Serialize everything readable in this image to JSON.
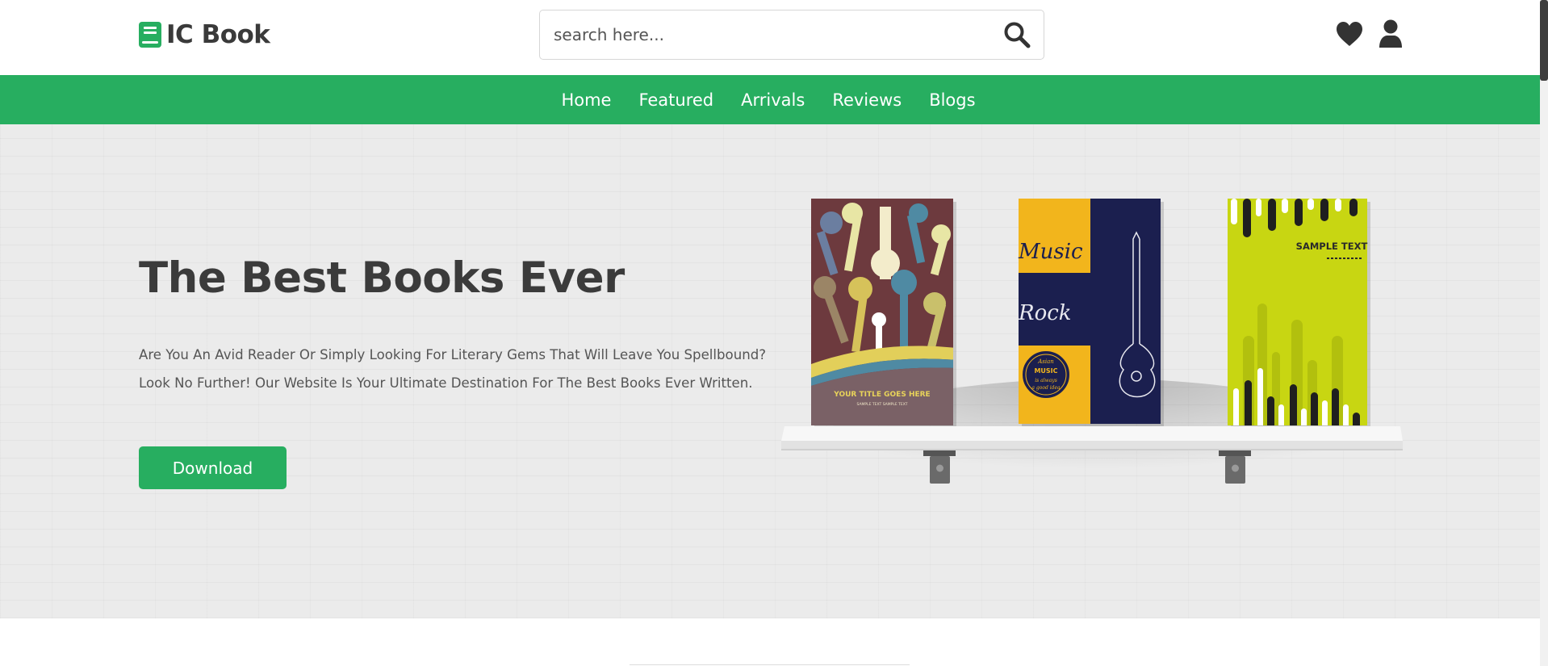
{
  "header": {
    "logo_text": "IC Book",
    "search": {
      "placeholder": "search here...",
      "value": ""
    }
  },
  "icons": {
    "logo": "book-icon",
    "search": "search-icon",
    "wishlist": "heart-icon",
    "account": "user-icon"
  },
  "nav": {
    "links": [
      "Home",
      "Featured",
      "Arrivals",
      "Reviews",
      "Blogs"
    ]
  },
  "hero": {
    "title": "The Best Books Ever",
    "description": "Are You An Avid Reader Or Simply Looking For Literary Gems That Will Leave You Spellbound? Look No Further! Our Website Is Your Ultimate Destination For The Best Books Ever Written.",
    "button_label": "Download"
  },
  "book_covers": {
    "book1": {
      "title_text": "YOUR TITLE GOES HERE",
      "subtitle_text": "SAMPLE TEXT SAMPLE TEXT"
    },
    "book2": {
      "word1": "Music",
      "word2": "Rock",
      "badge_lines": [
        "Asian",
        "MUSIC",
        "is always",
        "a good idea"
      ]
    },
    "book3": {
      "title_text": "SAMPLE TEXT"
    }
  },
  "colors": {
    "brand_green": "#27ae60",
    "text_dark": "#3b3b3b",
    "hero_background": "#ebebeb",
    "book1_cover": "#6d3a3e",
    "book2_yellow": "#f2b51c",
    "book2_navy": "#1b1f4f",
    "book3_lime": "#c8d612"
  }
}
